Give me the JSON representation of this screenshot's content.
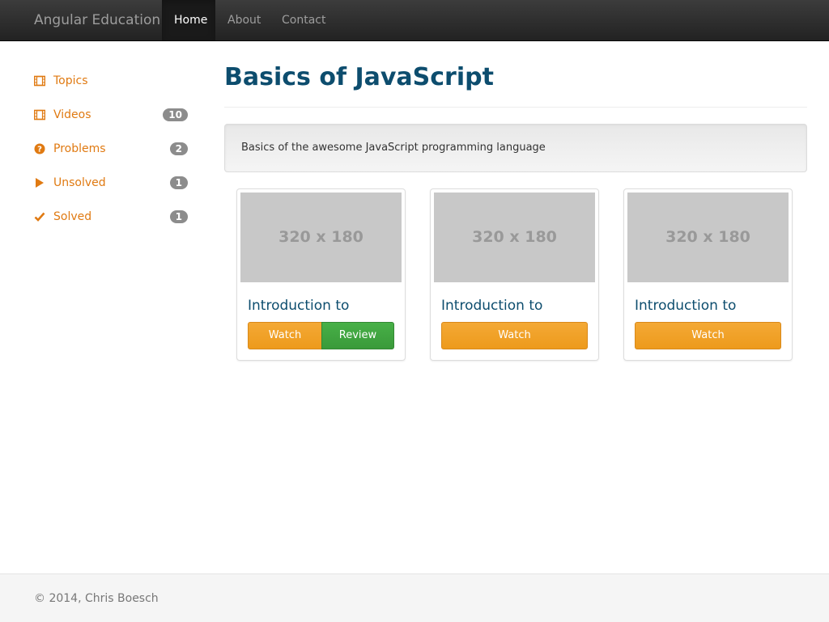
{
  "navbar": {
    "brand": "Angular Education",
    "items": [
      {
        "label": "Home",
        "active": true
      },
      {
        "label": "About",
        "active": false
      },
      {
        "label": "Contact",
        "active": false
      }
    ]
  },
  "sidebar": {
    "items": [
      {
        "label": "Topics",
        "icon": "film-icon",
        "badge": ""
      },
      {
        "label": "Videos",
        "icon": "film-icon",
        "badge": "10"
      },
      {
        "label": "Problems",
        "icon": "question-circle-icon",
        "badge": "2"
      },
      {
        "label": "Unsolved",
        "icon": "play-icon",
        "badge": "1"
      },
      {
        "label": "Solved",
        "icon": "check-icon",
        "badge": "1"
      }
    ]
  },
  "main": {
    "title": "Basics of JavaScript",
    "description": "Basics of the awesome JavaScript programming language",
    "cards": [
      {
        "thumb_label": "320 x 180",
        "title": "Introduction to",
        "watch_label": "Watch",
        "review_label": "Review"
      },
      {
        "thumb_label": "320 x 180",
        "title": "Introduction to",
        "watch_label": "Watch"
      },
      {
        "thumb_label": "320 x 180",
        "title": "Introduction to",
        "watch_label": "Watch"
      }
    ]
  },
  "footer": {
    "text": "© 2014, Chris Boesch"
  },
  "colors": {
    "accent": "#e07a12",
    "title": "#0d4d6e",
    "watch": "#ed9a1c",
    "review": "#3a9a3a",
    "badge": "#8c8c8c"
  }
}
